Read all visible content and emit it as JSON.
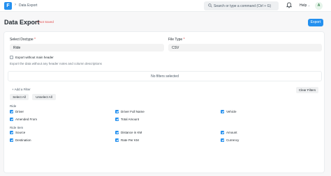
{
  "navbar": {
    "logo_letter": "F",
    "breadcrumb_chevron": "›",
    "breadcrumb": "Data Export",
    "search_placeholder": "Search or type a command (Ctrl + G)",
    "help_label": "Help",
    "help_chevron": "⌄",
    "avatar_initial": "A"
  },
  "page": {
    "title": "Data Export",
    "status": "• Not Saved",
    "primary_button": "Export"
  },
  "form": {
    "doctype_label": "Select Doctype",
    "doctype_value": "Ride",
    "file_type_label": "File Type",
    "file_type_value": "CSV",
    "required_mark": "*",
    "export_without_header_label": "Export without main header",
    "export_without_header_checked": false,
    "description": "Export the data without any header notes and column descriptions",
    "no_filters": "No filters selected",
    "add_filter": "+ Add a Filter",
    "clear_filters": "Clear Filters",
    "select_all": "Select All",
    "unselect_all": "Unselect All"
  },
  "sections": [
    {
      "title": "Ride",
      "fields": [
        {
          "label": "Driver",
          "checked": true
        },
        {
          "label": "Driver Full Name",
          "checked": true
        },
        {
          "label": "Vehicle",
          "checked": true
        },
        {
          "label": "Amended From",
          "checked": true
        },
        {
          "label": "Total Amount",
          "checked": true
        }
      ]
    },
    {
      "title": "Ride Item",
      "fields": [
        {
          "label": "Source",
          "checked": true
        },
        {
          "label": "Distance in KM",
          "checked": true
        },
        {
          "label": "Amount",
          "checked": true
        },
        {
          "label": "Destination",
          "checked": true
        },
        {
          "label": "Rate Per KM",
          "checked": true
        },
        {
          "label": "Currency",
          "checked": true
        }
      ]
    }
  ],
  "colors": {
    "primary": "#2490ef",
    "danger": "#e24c4c",
    "background": "#f7f7f8"
  }
}
